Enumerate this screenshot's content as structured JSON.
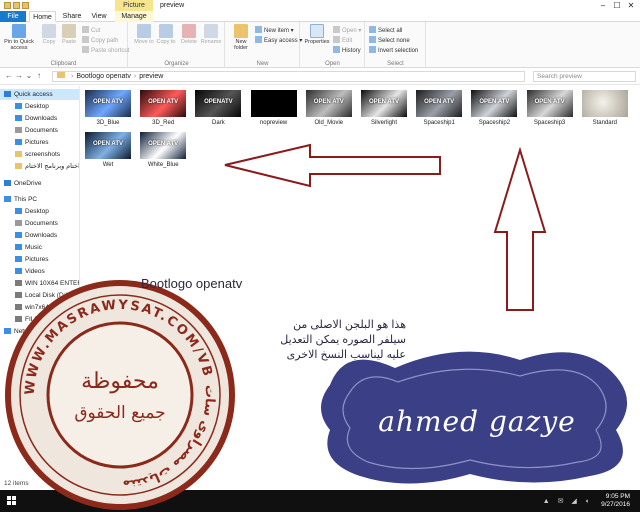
{
  "window": {
    "title": "preview",
    "context_tab": "Picture Tools",
    "controls": [
      "–",
      "☐",
      "✕"
    ]
  },
  "ribbon_tabs": [
    {
      "label": "File"
    },
    {
      "label": "Home"
    },
    {
      "label": "Share"
    },
    {
      "label": "View"
    },
    {
      "label": "Manage"
    }
  ],
  "ribbon": {
    "clipboard": {
      "name": "Clipboard",
      "pin": "Pin to Quick access",
      "copy": "Copy",
      "paste": "Paste",
      "cut": "Cut",
      "copy_path": "Copy path",
      "paste_shortcut": "Paste shortcut"
    },
    "organize": {
      "name": "Organize",
      "move_to": "Move to",
      "copy_to": "Copy to",
      "delete": "Delete",
      "rename": "Rename"
    },
    "new": {
      "name": "New",
      "new_folder": "New folder",
      "new_item": "New item ▾",
      "easy_access": "Easy access ▾"
    },
    "open": {
      "name": "Open",
      "properties": "Properties",
      "open": "Open ▾",
      "edit": "Edit",
      "history": "History"
    },
    "select": {
      "name": "Select",
      "select_all": "Select all",
      "select_none": "Select none",
      "invert": "Invert selection"
    }
  },
  "address": {
    "path": [
      "Bootlogo openatv",
      "preview"
    ],
    "search_placeholder": "Search preview"
  },
  "nav": {
    "quick_access": "Quick access",
    "items": [
      {
        "label": "Quick access",
        "icon": "star-icon",
        "color": "#2d7fd3"
      },
      {
        "label": "Desktop",
        "icon": "desktop-icon",
        "color": "#3a8ee6"
      },
      {
        "label": "Downloads",
        "icon": "download-icon",
        "color": "#3a8ee6"
      },
      {
        "label": "Documents",
        "icon": "document-icon",
        "color": "#9a9a9a"
      },
      {
        "label": "Pictures",
        "icon": "picture-icon",
        "color": "#3a8ee6"
      },
      {
        "label": "screenshots",
        "icon": "folder-icon",
        "color": "#e9c46a"
      },
      {
        "label": "اختام وبرنامج الاختام",
        "icon": "folder-icon",
        "color": "#e9c46a"
      },
      {
        "label": "OneDrive",
        "icon": "cloud-icon",
        "color": "#2d7fd3"
      },
      {
        "label": "This PC",
        "icon": "computer-icon",
        "color": "#3a8ee6"
      },
      {
        "label": "Desktop",
        "icon": "desktop-icon",
        "color": "#3a8ee6"
      },
      {
        "label": "Documents",
        "icon": "document-icon",
        "color": "#9a9a9a"
      },
      {
        "label": "Downloads",
        "icon": "download-icon",
        "color": "#3a8ee6"
      },
      {
        "label": "Music",
        "icon": "music-icon",
        "color": "#3a8ee6"
      },
      {
        "label": "Pictures",
        "icon": "picture-icon",
        "color": "#3a8ee6"
      },
      {
        "label": "Videos",
        "icon": "video-icon",
        "color": "#3a8ee6"
      },
      {
        "label": "WIN 10X64 ENTER",
        "icon": "drive-icon",
        "color": "#7a7a7a"
      },
      {
        "label": "Local Disk (D:)",
        "icon": "drive-icon",
        "color": "#7a7a7a"
      },
      {
        "label": "win7x64 ultimate",
        "icon": "drive-icon",
        "color": "#7a7a7a"
      },
      {
        "label": "FILL (F:)",
        "icon": "drive-icon",
        "color": "#7a7a7a"
      },
      {
        "label": "Network",
        "icon": "network-icon",
        "color": "#3a8ee6"
      }
    ]
  },
  "files": [
    {
      "name": "3D_Blue",
      "thumb": "#1a2a4a",
      "accent": "#6fa8ff",
      "text": "OPEN ATV"
    },
    {
      "name": "3D_Red",
      "thumb": "#2a0a0a",
      "accent": "#ff5b5b",
      "text": "OPEN ATV"
    },
    {
      "name": "Dark",
      "thumb": "#050505",
      "accent": "#555555",
      "text": "OPENATV"
    },
    {
      "name": "nopreview",
      "thumb": "#000000",
      "accent": "#000000",
      "text": ""
    },
    {
      "name": "Old_Movie",
      "thumb": "#2b2b2b",
      "accent": "#bdbdbd",
      "text": "OPEN ATV"
    },
    {
      "name": "Silverlight",
      "thumb": "#0a0a0a",
      "accent": "#e6e6e6",
      "text": "OPEN ATV"
    },
    {
      "name": "Spaceship1",
      "thumb": "#1b1b1b",
      "accent": "#9aa0a8",
      "text": "OPEN ATV"
    },
    {
      "name": "Spaceship2",
      "thumb": "#0e0e0e",
      "accent": "#cfd3d8",
      "text": "OPEN ATV"
    },
    {
      "name": "Spaceship3",
      "thumb": "#2a2a2a",
      "accent": "#d8d8d8",
      "text": "OPEN ATV"
    },
    {
      "name": "Standard",
      "thumb": "#d6d2c8",
      "accent": "#8a8576",
      "text": ""
    },
    {
      "name": "Wet",
      "thumb": "#0b1a2e",
      "accent": "#7fb0e6",
      "text": "OPEN ATV"
    },
    {
      "name": "White_Blue",
      "thumb": "#0d1f3a",
      "accent": "#ffffff",
      "text": "OPEN ATV"
    }
  ],
  "status": {
    "text": "12 items"
  },
  "taskbar": {
    "time": "9:05 PM",
    "date": "9/27/2016"
  },
  "overlay": {
    "caption": "Bootlogo openatv",
    "arabic_lines": [
      "هذا هو البلجن الاصلى من",
      "سيلفر الصوره يمكن التعديل",
      "عليه ليناسب النسخ الاخرى"
    ],
    "signature": "ahmed gazye",
    "stamp_center": "محفوظة جميع الحقوق",
    "stamp_ring": "WWW.MASRAWYSAT.COM/VB منتديات مصراوى سات",
    "arrow_color": "#8b1a1a",
    "stamp_color": "#8b2a1a",
    "badge_color": "#3b3f86"
  }
}
